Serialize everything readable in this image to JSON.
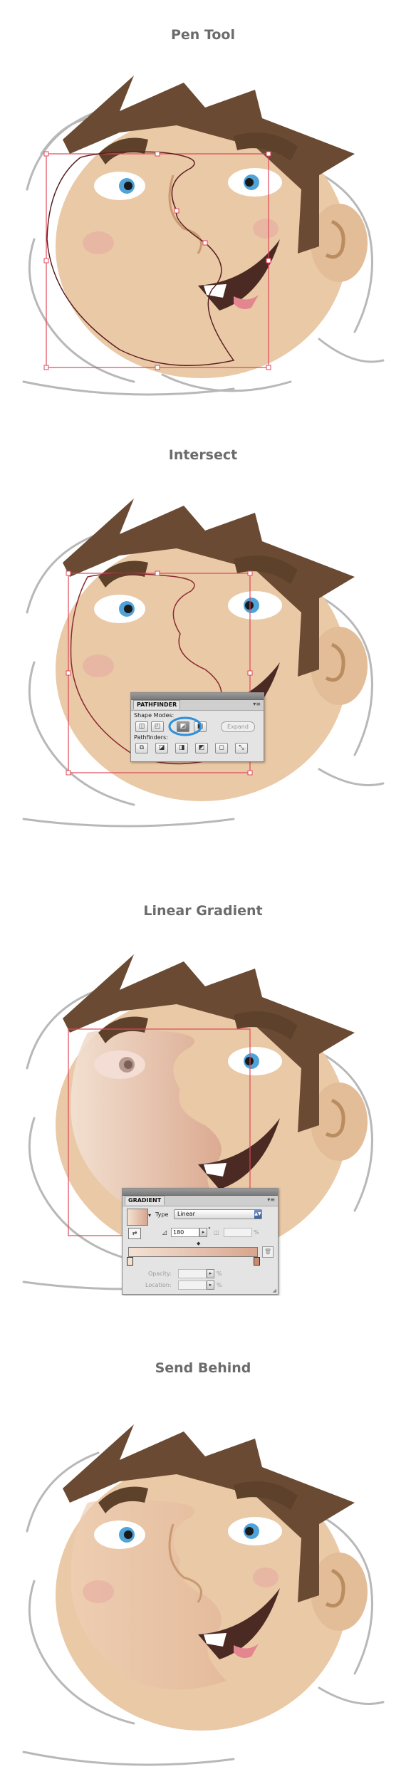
{
  "steps": [
    {
      "title": "Pen Tool"
    },
    {
      "title": "Intersect"
    },
    {
      "title": "Linear Gradient"
    },
    {
      "title": "Send Behind"
    }
  ],
  "pathfinder_panel": {
    "tab_label": "PATHFINDER",
    "shape_modes_label": "Shape Modes:",
    "pathfinders_label": "Pathfinders:",
    "expand_label": "Expand",
    "shape_mode_buttons": [
      "unite-icon",
      "minus-front-icon",
      "intersect-icon",
      "exclude-icon"
    ],
    "pathfinder_buttons": [
      "divide-icon",
      "trim-icon",
      "merge-icon",
      "crop-icon",
      "outline-icon",
      "minus-back-icon"
    ]
  },
  "gradient_panel": {
    "tab_label": "GRADIENT",
    "type_label": "Type",
    "type_value": "Linear",
    "angle_value": "180",
    "angle_unit": "°",
    "opacity_label": "Opacity:",
    "location_label": "Location:",
    "percent_symbol": "%"
  },
  "colors": {
    "skin": "#eac9a6",
    "hair": "#6a4a32",
    "eye_blue": "#4fa3d8",
    "selection": "#e0475a",
    "title_gray": "#6b6b6b"
  }
}
